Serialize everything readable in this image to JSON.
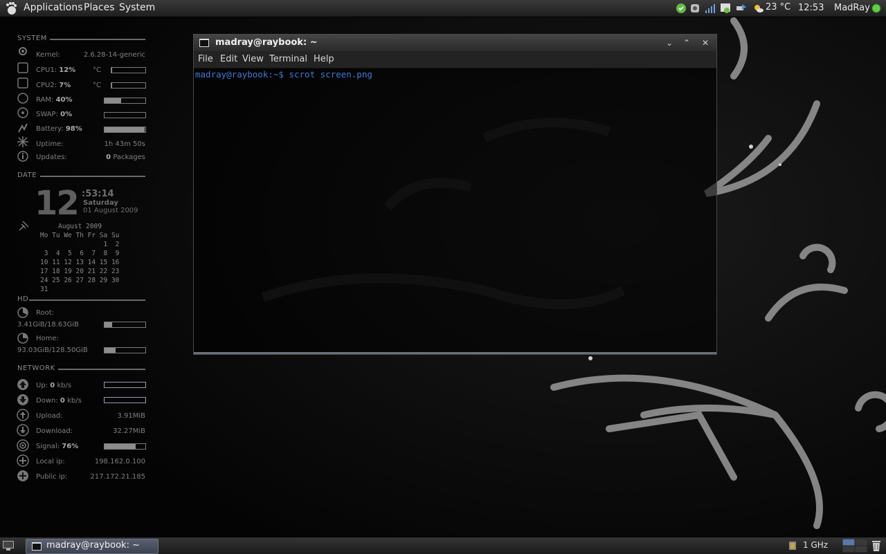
{
  "top_panel": {
    "menus": [
      "Applications",
      "Places",
      "System"
    ],
    "weather": "23 °C",
    "clock": "12:53",
    "user": "MadRay"
  },
  "conky": {
    "system_header": "SYSTEM",
    "kernel_label": "Kernel:",
    "kernel_value": "2.6.28-14-generic",
    "cpu1_label": "CPU1:",
    "cpu1_value": "12%",
    "cpu1_temp": "°C",
    "cpu1_level": 0.02,
    "cpu2_label": "CPU2:",
    "cpu2_value": "7%",
    "cpu2_temp": "°C",
    "cpu2_level": 0.02,
    "ram_label": "RAM:",
    "ram_value": "40%",
    "ram_level": 0.4,
    "swap_label": "SWAP:",
    "swap_value": "0%",
    "swap_level": 0.0,
    "battery_label": "Battery:",
    "battery_value": "98%",
    "battery_level": 0.98,
    "uptime_label": "Uptime:",
    "uptime_value": "1h 43m 50s",
    "updates_label": "Updates:",
    "updates_count": "0",
    "updates_unit": "Packages",
    "date_header": "DATE",
    "hour": "12",
    "time_rest": ":53:14",
    "day_name": "Saturday",
    "full_date": "01 August 2009",
    "calendar": {
      "title": "August 2009",
      "weekdays": "Mo Tu We Th Fr Sa Su",
      "rows": [
        "                1  2",
        " 3  4  5  6  7  8  9",
        "10 11 12 13 14 15 16",
        "17 18 19 20 21 22 23",
        "24 25 26 27 28 29 30",
        "31"
      ]
    },
    "hd_header": "HD",
    "root_label": "Root:",
    "root_value": "3.41GiB/18.63GiB",
    "root_level": 0.18,
    "home_label": "Home:",
    "home_value": "93.03GiB/128.50GiB",
    "home_level": 0.27,
    "network_header": "NETWORK",
    "up_label": "Up:",
    "up_value": "0",
    "up_unit": "kb/s",
    "down_label": "Down:",
    "down_value": "0",
    "down_unit": "kb/s",
    "upload_label": "Upload:",
    "upload_value": "3.91MiB",
    "download_label": "Download:",
    "download_value": "32.27MiB",
    "signal_label": "Signal:",
    "signal_value": "76%",
    "signal_level": 0.76,
    "local_ip_label": "Local ip:",
    "local_ip_value": "198.162.0.100",
    "public_ip_label": "Public ip:",
    "public_ip_value": "217.172.21.185"
  },
  "terminal": {
    "title": "madray@raybook: ~",
    "menus": [
      "File",
      "Edit",
      "View",
      "Terminal",
      "Help"
    ],
    "prompt": "madray@raybook:~$",
    "command": " scrot screen.png"
  },
  "bottom_panel": {
    "task_label": "madray@raybook: ~",
    "cpu_freq": "1 GHz"
  },
  "colors": {
    "prompt": "#3d7bd6",
    "panel": "#2a2a2a",
    "task_active": "#4a5060"
  }
}
